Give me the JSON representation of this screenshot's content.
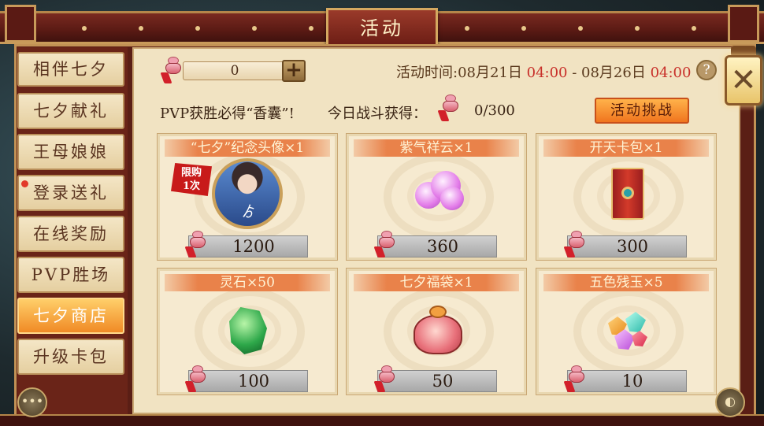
{
  "header": {
    "title": "活动"
  },
  "sidebar": {
    "items": [
      {
        "label": "相伴七夕"
      },
      {
        "label": "七夕献礼"
      },
      {
        "label": "王母娘娘"
      },
      {
        "label": "登录送礼"
      },
      {
        "label": "在线奖励"
      },
      {
        "label": "PVP胜场"
      },
      {
        "label": "七夕商店"
      },
      {
        "label": "升级卡包"
      }
    ],
    "active_index": 6
  },
  "currency": {
    "value": "0",
    "plus_label": "+"
  },
  "event_time": {
    "label": "活动时间:",
    "start_date": "08月21日",
    "start_time": "04:00",
    "separator": " - ",
    "end_date": "08月26日",
    "end_time": "04:00"
  },
  "help_label": "?",
  "close_label": "✕",
  "pvp_notice": "PVP获胜必得“香囊”!",
  "today": {
    "label": "今日战斗获得：",
    "count": "0/300"
  },
  "challenge_button": "活动挑战",
  "shop": {
    "items": [
      {
        "name": "“七夕”纪念头像×1",
        "price": "1200",
        "limit_badge": "限购\n1次",
        "portrait_glyph": "ゟ"
      },
      {
        "name": "紫气祥云×1",
        "price": "360"
      },
      {
        "name": "开天卡包×1",
        "price": "300"
      },
      {
        "name": "灵石×50",
        "price": "100"
      },
      {
        "name": "七夕福袋×1",
        "price": "50"
      },
      {
        "name": "五色残玉×5",
        "price": "10"
      }
    ]
  },
  "colors": {
    "accent": "#e9824a",
    "time_red": "#c8302a",
    "active_tab": "#f08a25"
  }
}
